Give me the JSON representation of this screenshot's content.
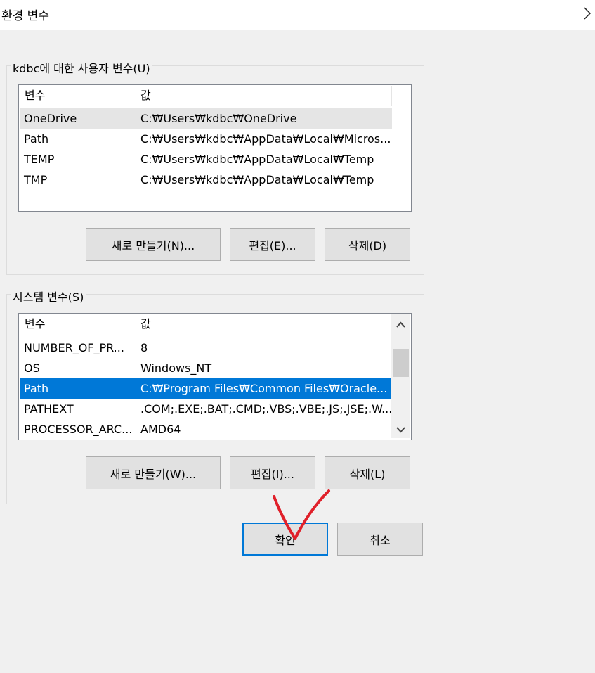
{
  "window": {
    "title": "환경 변수"
  },
  "user_group": {
    "label": "kdbc에 대한 사용자 변수(U)",
    "headers": {
      "name": "변수",
      "value": "값"
    },
    "rows": [
      {
        "name": "OneDrive",
        "value": "C:₩Users₩kdbc₩OneDrive"
      },
      {
        "name": "Path",
        "value": "C:₩Users₩kdbc₩AppData₩Local₩Micros..."
      },
      {
        "name": "TEMP",
        "value": "C:₩Users₩kdbc₩AppData₩Local₩Temp"
      },
      {
        "name": "TMP",
        "value": "C:₩Users₩kdbc₩AppData₩Local₩Temp"
      }
    ],
    "buttons": {
      "new": "새로 만들기(N)...",
      "edit": "편집(E)...",
      "delete": "삭제(D)"
    }
  },
  "system_group": {
    "label": "시스템 변수(S)",
    "headers": {
      "name": "변수",
      "value": "값"
    },
    "rows": [
      {
        "name": "NUMBER_OF_PR...",
        "value": "8"
      },
      {
        "name": "OS",
        "value": "Windows_NT"
      },
      {
        "name": "Path",
        "value": "C:₩Program Files₩Common Files₩Oracle..."
      },
      {
        "name": "PATHEXT",
        "value": ".COM;.EXE;.BAT;.CMD;.VBS;.VBE;.JS;.JSE;.W..."
      },
      {
        "name": "PROCESSOR_ARC...",
        "value": "AMD64"
      }
    ],
    "selected_row": "Path",
    "buttons": {
      "new": "새로 만들기(W)...",
      "edit": "편집(I)...",
      "delete": "삭제(L)"
    }
  },
  "dialog_buttons": {
    "ok": "확인",
    "cancel": "취소"
  },
  "colors": {
    "selection": "#0078d7",
    "annotation": "#e0202a",
    "window_bg": "#f0f0f0"
  },
  "icons": {
    "title_chevron": "chevron-right-icon",
    "scroll_up": "chevron-up-icon",
    "scroll_down": "chevron-down-icon"
  }
}
